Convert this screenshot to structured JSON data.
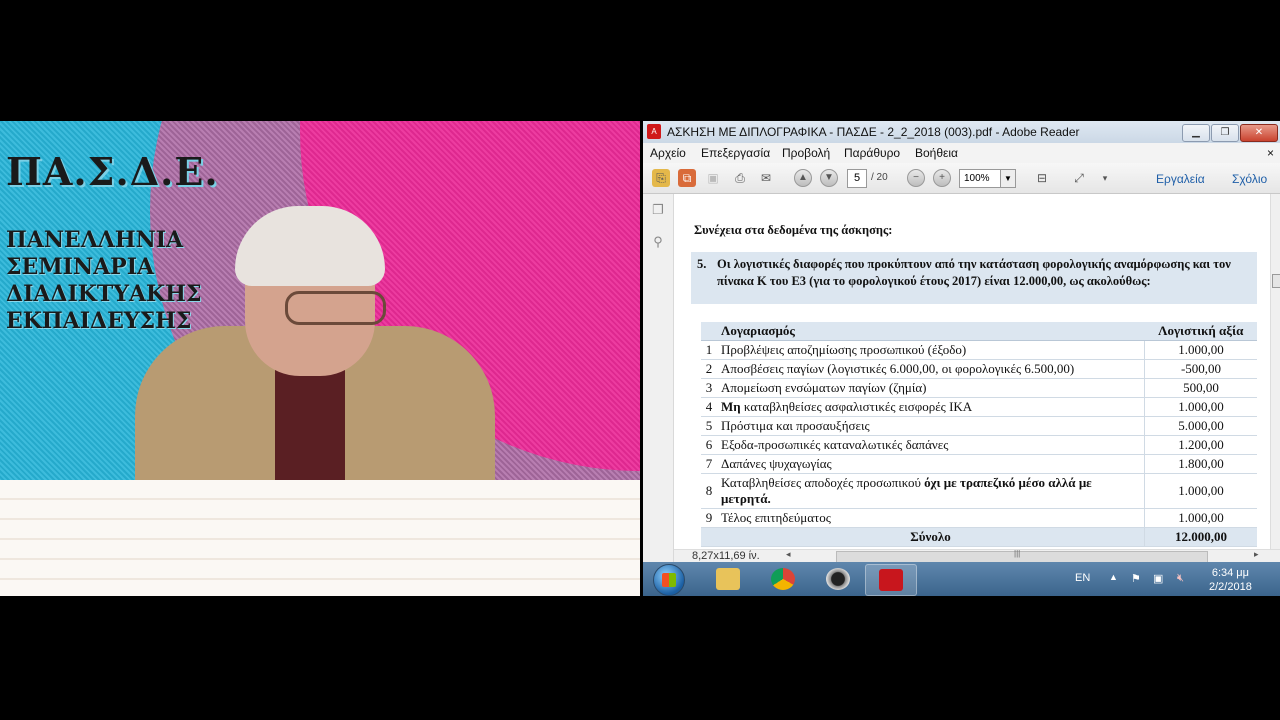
{
  "video": {
    "logo": "ΠΑ.Σ.Δ.Ε.",
    "subtitle_lines": [
      "ΠΑΝΕΛΛΗΝΙΑ",
      "ΣΕΜΙΝΑΡΙΑ",
      "ΔΙΑΔΙΚΤΥΑΚΗΣ",
      "ΕΚΠΑΙΔΕΥΣΗΣ"
    ]
  },
  "window": {
    "title": "ΑΣΚΗΣΗ ΜΕ ΔΙΠΛΟΓΡΑΦΙΚΑ - ΠΑΣΔΕ - 2_2_2018 (003).pdf - Adobe Reader",
    "controls": {
      "minimize": "▁",
      "restore": "❐",
      "close": "✕"
    }
  },
  "menu": {
    "file": "Αρχείο",
    "edit": "Επεξεργασία",
    "view": "Προβολή",
    "window": "Παράθυρο",
    "help": "Βοήθεια",
    "close_x": "×"
  },
  "toolbar": {
    "current_page": "5",
    "total_pages": "/ 20",
    "zoom": "100%",
    "tools": "Εργαλεία",
    "comment": "Σχόλιο"
  },
  "document": {
    "heading": "Συνέχεια στα δεδομένα της άσκησης:",
    "item5_number": "5.",
    "item5_text": "Οι λογιστικές διαφορές που προκύπτουν από την κατάσταση φορολογικής αναμόρφωσης και τον πίνακα Κ του Ε3 (για το φορολογικού έτους 2017) είναι 12.000,00, ως ακολούθως:",
    "table": {
      "headers": {
        "account": "Λογαριασμός",
        "value": "Λογιστική αξία"
      },
      "rows": [
        {
          "n": "1",
          "label": "Προβλέψεις αποζημίωσης προσωπικού (έξοδο)",
          "value": "1.000,00"
        },
        {
          "n": "2",
          "label": "Αποσβέσεις παγίων (λογιστικές 6.000,00, οι φορολογικές 6.500,00)",
          "value": "-500,00"
        },
        {
          "n": "3",
          "label": "Απομείωση ενσώματων παγίων (ζημία)",
          "value": "500,00"
        },
        {
          "n": "4",
          "label_bold": "Μη",
          "label_rest": " καταβληθείσες ασφαλιστικές εισφορές ΙΚΑ",
          "value": "1.000,00"
        },
        {
          "n": "5",
          "label": "Πρόστιμα και προσαυξήσεις",
          "value": "5.000,00"
        },
        {
          "n": "6",
          "label": "Εξοδα-προσωπικές καταναλωτικές δαπάνες",
          "value": "1.200,00"
        },
        {
          "n": "7",
          "label": "Δαπάνες ψυχαγωγίας",
          "value": "1.800,00"
        },
        {
          "n": "8",
          "label_rest": "Καταβληθείσες αποδοχές προσωπικού ",
          "label_bold": "όχι με τραπεζικό μέσο αλλά με μετρητά.",
          "value": "1.000,00"
        },
        {
          "n": "9",
          "label": "Τέλος επιτηδεύματος",
          "value": "1.000,00"
        }
      ],
      "total_label": "Σύνολο",
      "total_value": "12.000,00"
    }
  },
  "status": {
    "page_size": "8,27x11,69 ίν."
  },
  "taskbar": {
    "lang": "EN",
    "time": "6:34 μμ",
    "date": "2/2/2018"
  },
  "colors": {
    "table_header_bg": "#dce6f0",
    "link_blue": "#1f5fa8",
    "taskbar": "#4a729a"
  }
}
